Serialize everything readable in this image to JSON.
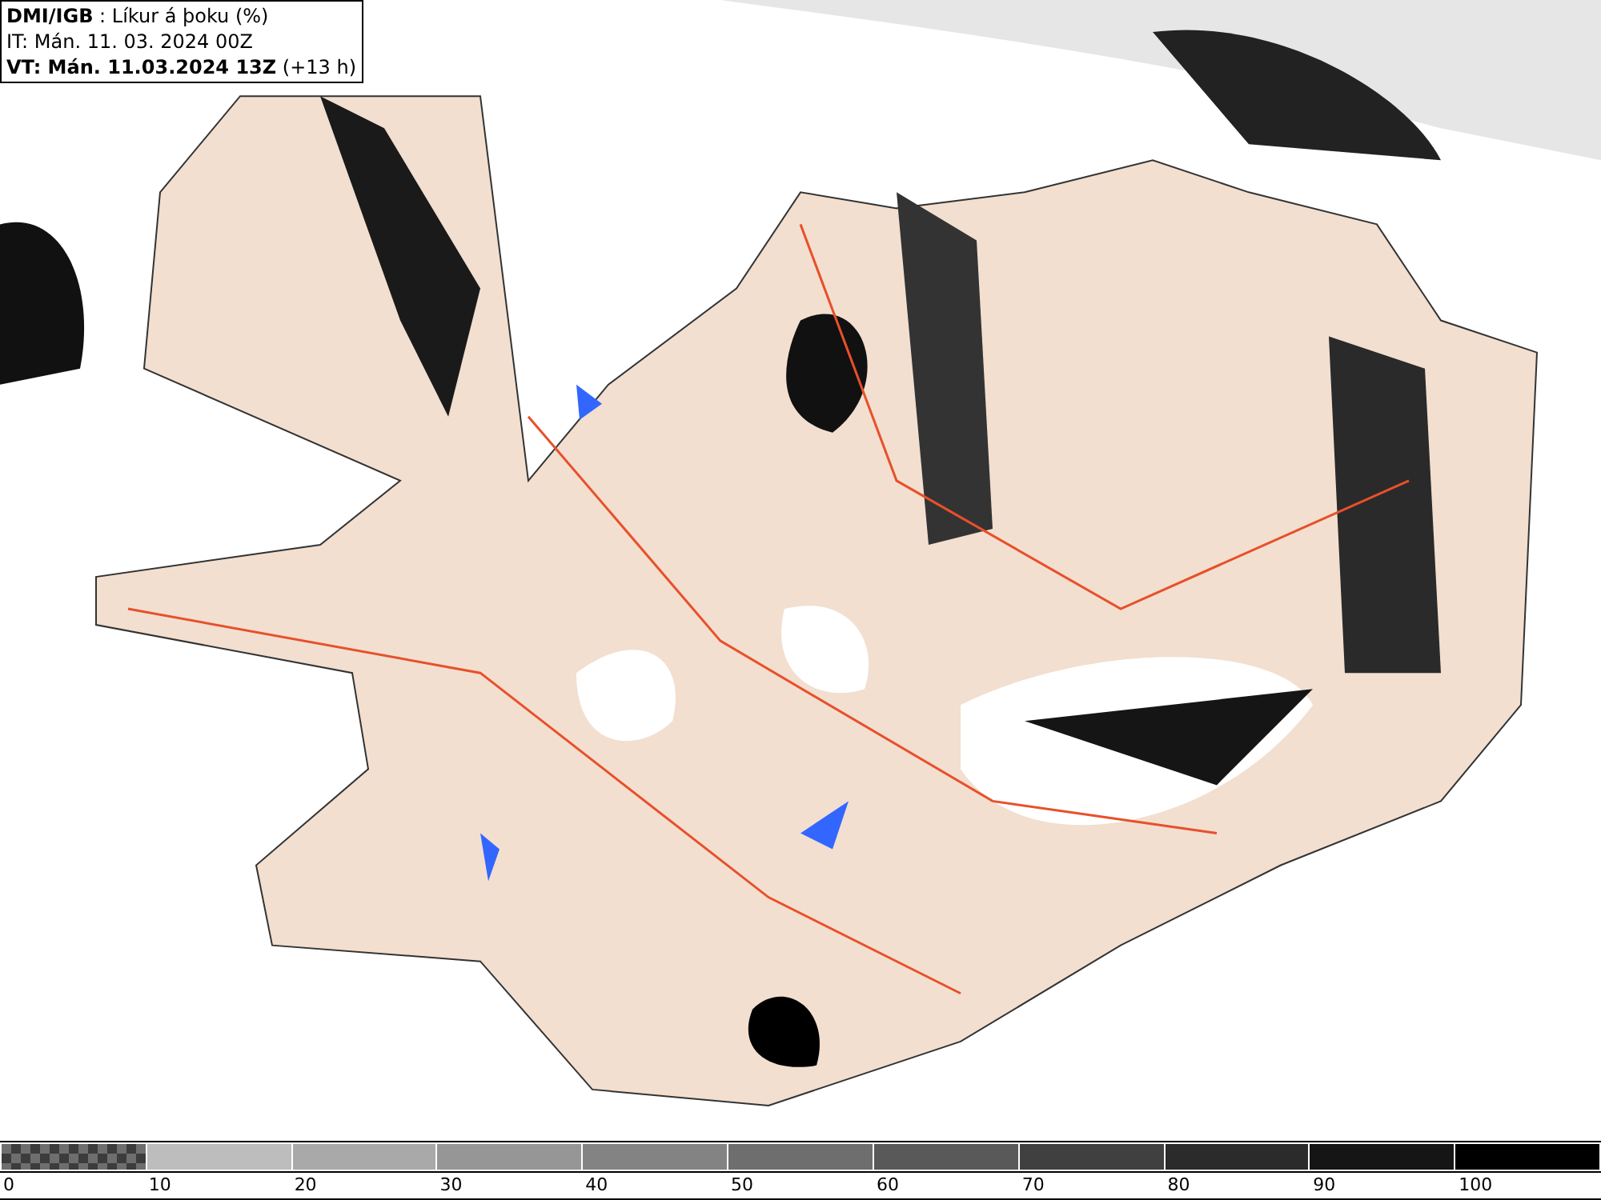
{
  "header": {
    "lines": [
      "**DMI/IGB** : Líkur á þoku (%)",
      "IT: Mán. 11. 03. 2024 00Z",
      "**VT: Mán. 11.03.2024 13Z** (+13 h)"
    ]
  },
  "legend": {
    "segments": [
      {
        "kind": "checker",
        "label": "0"
      },
      {
        "kind": "solid",
        "color": "#bdbdbd",
        "label": "10"
      },
      {
        "kind": "solid",
        "color": "#a9a9a9",
        "label": "20"
      },
      {
        "kind": "solid",
        "color": "#969696",
        "label": "30"
      },
      {
        "kind": "solid",
        "color": "#838383",
        "label": "40"
      },
      {
        "kind": "solid",
        "color": "#6e6e6e",
        "label": "50"
      },
      {
        "kind": "solid",
        "color": "#595959",
        "label": "60"
      },
      {
        "kind": "solid",
        "color": "#404040",
        "label": "70"
      },
      {
        "kind": "solid",
        "color": "#2b2b2b",
        "label": "80"
      },
      {
        "kind": "solid",
        "color": "#151515",
        "label": "90"
      },
      {
        "kind": "solid",
        "color": "#000000",
        "label": "100"
      }
    ]
  }
}
